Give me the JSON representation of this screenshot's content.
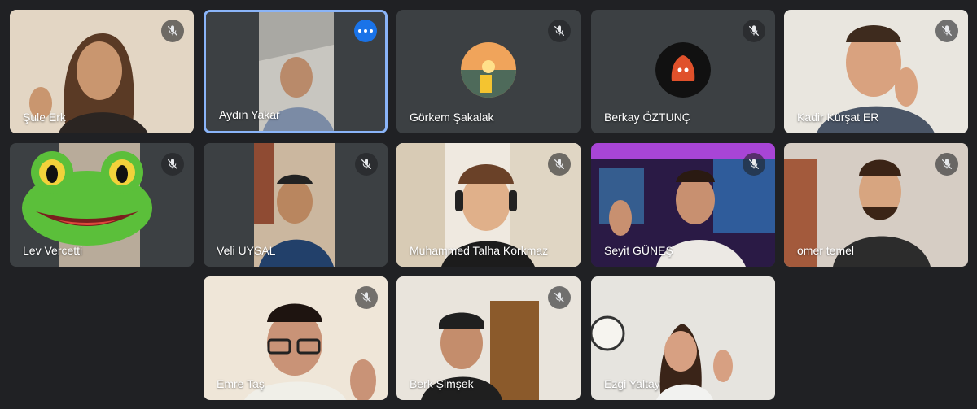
{
  "app": "Video meeting",
  "colors": {
    "background": "#202124",
    "tile_empty": "#3c4043",
    "active_border": "#8ab4f8",
    "more_button": "#1a73e8",
    "name_text": "#ffffff"
  },
  "participants": [
    {
      "name": "Şule Erk",
      "muted": true,
      "video": true
    },
    {
      "name": "Aydın Yakar",
      "muted": false,
      "video": true,
      "active": true
    },
    {
      "name": "Görkem Şakalak",
      "muted": true,
      "video": false,
      "avatar": "sunset-photo"
    },
    {
      "name": "Berkay ÖZTUNÇ",
      "muted": true,
      "video": false,
      "avatar": "champion-logo"
    },
    {
      "name": "Kadir Kürşat ER",
      "muted": true,
      "video": true
    },
    {
      "name": "Lev Vercetti",
      "muted": true,
      "video": true,
      "effect": "frog-mask"
    },
    {
      "name": "Veli UYSAL",
      "muted": true,
      "video": true
    },
    {
      "name": "Muhammed Talha Korkmaz",
      "muted": true,
      "video": true
    },
    {
      "name": "Seyit GÜNEŞ",
      "muted": true,
      "video": true
    },
    {
      "name": "omer temel",
      "muted": true,
      "video": true
    },
    {
      "name": "Emre Taş",
      "muted": true,
      "video": true
    },
    {
      "name": "Berk Şimşek",
      "muted": true,
      "video": true
    },
    {
      "name": "Ezgi Yaltay",
      "muted": false,
      "video": true
    }
  ],
  "icons": {
    "mute": "mic-off-icon",
    "more": "more-options-icon"
  }
}
